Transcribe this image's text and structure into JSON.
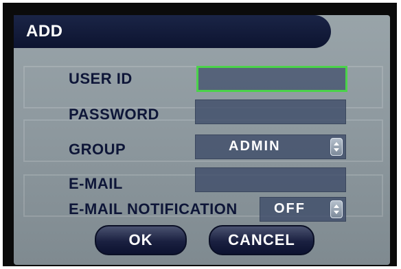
{
  "dialog": {
    "title": "ADD"
  },
  "fields": {
    "user_id": {
      "label": "USER ID",
      "value": ""
    },
    "password": {
      "label": "PASSWORD",
      "value": ""
    },
    "group": {
      "label": "GROUP",
      "value": "ADMIN"
    },
    "email": {
      "label": "E-MAIL",
      "value": ""
    },
    "email_notification": {
      "label": "E-MAIL NOTIFICATION",
      "value": "OFF"
    }
  },
  "buttons": {
    "ok": "OK",
    "cancel": "CANCEL"
  },
  "icons": {
    "spinner": "up-down-spinner-icon"
  },
  "colors": {
    "accent_green": "#4bd34a",
    "title_bar": "#0d1430",
    "label_text": "#0e1638"
  }
}
